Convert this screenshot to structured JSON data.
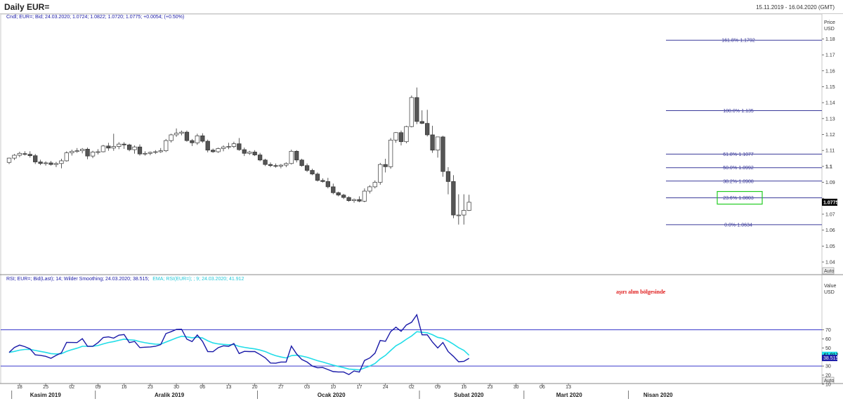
{
  "header": {
    "title": "Daily EUR=",
    "date_range": "15.11.2019 - 16.04.2020 (GMT)",
    "price_legend": "Cndl; EUR=; Bid; 24.03.2020; 1.0724; 1.0822; 1.0720; 1.0775; +0.0054; (+0.50%)",
    "rsi_legend_main": "RSI; EUR=; Bid(Last);  14; Wilder Smoothing; 24.03.2020; 38.515;",
    "rsi_legend_ema": "EMA; RSI(EUR=); ; 9; 24.03.2020; 41.912",
    "price_axis_title": "Price",
    "price_axis_unit": "USD",
    "rsi_axis_title": "Value",
    "rsi_axis_unit": "USD",
    "auto_label": "Auto",
    "annotation": "aşırı alım bölgesinde"
  },
  "colors": {
    "candle_up_fill": "#ffffff",
    "candle_down_fill": "#555555",
    "fib_line": "#3a3a9a",
    "rsi_line": "#1a1aa8",
    "ema_line": "#22dde8",
    "rsi_bands": "#3a3acc",
    "annotation": "#e02020",
    "highlight_box": "#22cc22",
    "last_price_tag": "#000000"
  },
  "chart_data": [
    {
      "type": "candlestick",
      "y_axis_ticks": [
        1.04,
        1.05,
        1.06,
        1.07,
        1.08,
        1.09,
        1.1,
        1.11,
        1.12,
        1.13,
        1.14,
        1.15,
        1.16,
        1.17,
        1.18
      ],
      "y_axis_tick_labels": [
        "1.04",
        "1.05",
        "1.06",
        "1.07",
        "",
        "1.09",
        "1.1",
        "1.11",
        "1.12",
        "1.13",
        "1.14",
        "1.15",
        "1.16",
        "1.17",
        "1.18"
      ],
      "ylim": [
        1.034,
        1.187
      ],
      "last_price": "1.0775",
      "fibonacci_levels": [
        {
          "label": "161.8%-1.1792",
          "value": 1.1792
        },
        {
          "label": "100.0%-1.135",
          "value": 1.135
        },
        {
          "label": "61.8%-1.1077",
          "value": 1.1077
        },
        {
          "label": "50.0%-1.0992",
          "value": 1.0992
        },
        {
          "label": "38.2%-1.0908",
          "value": 1.0908
        },
        {
          "label": "23.6%-1.0803",
          "value": 1.0803
        },
        {
          "label": "0.0%-1.0634",
          "value": 1.0634
        }
      ],
      "candles": [
        [
          1.1025,
          1.1055,
          1.1015,
          1.1052
        ],
        [
          1.1052,
          1.1078,
          1.104,
          1.107
        ],
        [
          1.107,
          1.1092,
          1.1058,
          1.1082
        ],
        [
          1.108,
          1.1095,
          1.1068,
          1.1076
        ],
        [
          1.1076,
          1.1095,
          1.1055,
          1.1067
        ],
        [
          1.1067,
          1.1078,
          1.1015,
          1.1028
        ],
        [
          1.1028,
          1.1042,
          1.1008,
          1.1018
        ],
        [
          1.1018,
          1.1032,
          1.1005,
          1.1022
        ],
        [
          1.1022,
          1.1034,
          1.1005,
          1.1012
        ],
        [
          1.1012,
          1.1028,
          1.0995,
          1.1018
        ],
        [
          1.1018,
          1.1048,
          1.0988,
          1.1035
        ],
        [
          1.1035,
          1.1095,
          1.103,
          1.1085
        ],
        [
          1.1085,
          1.1105,
          1.1068,
          1.1095
        ],
        [
          1.1095,
          1.1115,
          1.1085,
          1.1098
        ],
        [
          1.1098,
          1.1115,
          1.1082,
          1.1108
        ],
        [
          1.1108,
          1.1118,
          1.1045,
          1.1065
        ],
        [
          1.1065,
          1.1098,
          1.1052,
          1.109
        ],
        [
          1.109,
          1.1108,
          1.1075,
          1.1092
        ],
        [
          1.1092,
          1.1135,
          1.1088,
          1.1128
        ],
        [
          1.1128,
          1.1148,
          1.1098,
          1.1115
        ],
        [
          1.1115,
          1.1205,
          1.1098,
          1.1125
        ],
        [
          1.1125,
          1.1152,
          1.1108,
          1.114
        ],
        [
          1.114,
          1.1152,
          1.111,
          1.1135
        ],
        [
          1.1135,
          1.1142,
          1.1095,
          1.1105
        ],
        [
          1.1105,
          1.1132,
          1.108,
          1.1122
        ],
        [
          1.1122,
          1.1138,
          1.1068,
          1.1078
        ],
        [
          1.1078,
          1.1095,
          1.1068,
          1.1082
        ],
        [
          1.1082,
          1.1093,
          1.107,
          1.1088
        ],
        [
          1.1088,
          1.1102,
          1.1078,
          1.1092
        ],
        [
          1.1092,
          1.1115,
          1.1085,
          1.1098
        ],
        [
          1.1098,
          1.1172,
          1.109,
          1.1162
        ],
        [
          1.1162,
          1.1205,
          1.115,
          1.1198
        ],
        [
          1.1198,
          1.1238,
          1.1185,
          1.1208
        ],
        [
          1.1208,
          1.1225,
          1.1195,
          1.1215
        ],
        [
          1.1215,
          1.1225,
          1.1155,
          1.1162
        ],
        [
          1.1162,
          1.1172,
          1.1128,
          1.1148
        ],
        [
          1.1148,
          1.1205,
          1.1135,
          1.1192
        ],
        [
          1.1192,
          1.1208,
          1.1148,
          1.1158
        ],
        [
          1.1158,
          1.1168,
          1.1088,
          1.1102
        ],
        [
          1.1102,
          1.1112,
          1.1085,
          1.1092
        ],
        [
          1.1092,
          1.1118,
          1.1085,
          1.1112
        ],
        [
          1.1112,
          1.1132,
          1.1095,
          1.1122
        ],
        [
          1.1122,
          1.1148,
          1.1108,
          1.1125
        ],
        [
          1.1125,
          1.1155,
          1.1115,
          1.1142
        ],
        [
          1.1142,
          1.1178,
          1.1098,
          1.1105
        ],
        [
          1.1105,
          1.1118,
          1.1065,
          1.1082
        ],
        [
          1.1082,
          1.1098,
          1.1072,
          1.109
        ],
        [
          1.109,
          1.1102,
          1.1065,
          1.1072
        ],
        [
          1.1072,
          1.1085,
          1.1032,
          1.104
        ],
        [
          1.104,
          1.1048,
          1.1002,
          1.1012
        ],
        [
          1.1012,
          1.1025,
          1.0995,
          1.1005
        ],
        [
          1.1005,
          1.1018,
          1.0992,
          1.1002
        ],
        [
          1.1002,
          1.1015,
          1.0988,
          1.1008
        ],
        [
          1.1008,
          1.1025,
          1.0995,
          1.1018
        ],
        [
          1.1018,
          1.1105,
          1.1012,
          1.1095
        ],
        [
          1.1095,
          1.1102,
          1.1025,
          1.104
        ],
        [
          1.104,
          1.1048,
          1.0998,
          1.1005
        ],
        [
          1.1005,
          1.1018,
          1.0965,
          1.0975
        ],
        [
          1.0975,
          1.0985,
          1.0945,
          1.0952
        ],
        [
          1.0952,
          1.0962,
          1.0905,
          1.0912
        ],
        [
          1.0912,
          1.0925,
          1.0898,
          1.0905
        ],
        [
          1.0905,
          1.0928,
          1.0862,
          1.0872
        ],
        [
          1.0872,
          1.0892,
          1.0825,
          1.0835
        ],
        [
          1.0835,
          1.0842,
          1.0812,
          1.082
        ],
        [
          1.082,
          1.0828,
          1.0795,
          1.0805
        ],
        [
          1.0805,
          1.0812,
          1.0778,
          1.0785
        ],
        [
          1.0785,
          1.0798,
          1.0772,
          1.0792
        ],
        [
          1.0792,
          1.0812,
          1.0775,
          1.0782
        ],
        [
          1.0782,
          1.0862,
          1.0775,
          1.0845
        ],
        [
          1.0845,
          1.0882,
          1.083,
          1.0872
        ],
        [
          1.0872,
          1.0912,
          1.0862,
          1.09
        ],
        [
          1.09,
          1.1022,
          1.0885,
          1.1012
        ],
        [
          1.1012,
          1.1048,
          1.0962,
          1.0998
        ],
        [
          1.0998,
          1.1178,
          1.0985,
          1.1165
        ],
        [
          1.1165,
          1.1215,
          1.1148,
          1.1212
        ],
        [
          1.1212,
          1.1225,
          1.1132,
          1.1155
        ],
        [
          1.1155,
          1.1255,
          1.1145,
          1.125
        ],
        [
          1.125,
          1.1445,
          1.1245,
          1.1432
        ],
        [
          1.1432,
          1.1495,
          1.1265,
          1.1282
        ],
        [
          1.1282,
          1.1352,
          1.1265,
          1.127
        ],
        [
          1.127,
          1.1355,
          1.1188,
          1.1198
        ],
        [
          1.1198,
          1.1255,
          1.1085,
          1.1102
        ],
        [
          1.1102,
          1.1185,
          1.1055,
          1.1185
        ],
        [
          1.1185,
          1.1192,
          1.0935,
          1.0968
        ],
        [
          1.0968,
          1.0995,
          1.0825,
          1.0905
        ],
        [
          1.0905,
          1.0945,
          1.0675,
          1.0695
        ],
        [
          1.0695,
          1.0825,
          1.0635,
          1.0695
        ],
        [
          1.0695,
          1.0825,
          1.0635,
          1.0724
        ],
        [
          1.0724,
          1.0822,
          1.072,
          1.0775
        ]
      ]
    },
    {
      "type": "line",
      "name": "RSI",
      "y_axis_ticks": [
        10,
        20,
        30,
        40,
        50,
        60,
        70
      ],
      "ylim": [
        0,
        100
      ],
      "overbought": 70,
      "oversold": 30,
      "last_rsi": "38.515",
      "last_ema": "41.912",
      "rsi_values": [
        45.0,
        50.5,
        53.1,
        51.4,
        48.9,
        42.3,
        41.8,
        40.7,
        38.5,
        41.8,
        44.5,
        56.1,
        56.0,
        55.9,
        60.2,
        51.8,
        51.7,
        55.8,
        61.5,
        62.2,
        60.8,
        64.0,
        64.7,
        55.9,
        57.1,
        50.4,
        50.8,
        51.1,
        51.8,
        53.7,
        65.8,
        67.9,
        70.4,
        70.6,
        59.6,
        57.0,
        64.3,
        57.2,
        46.0,
        45.8,
        50.2,
        52.3,
        51.8,
        54.8,
        43.8,
        46.2,
        46.0,
        46.0,
        42.7,
        39.1,
        33.3,
        33.1,
        34.4,
        34.4,
        52.0,
        43.3,
        37.2,
        34.4,
        30.0,
        28.1,
        28.4,
        26.1,
        23.9,
        23.4,
        23.4,
        20.6,
        24.6,
        23.3,
        36.1,
        38.9,
        44.2,
        58.2,
        57.3,
        68.0,
        72.9,
        68.3,
        75.3,
        78.3,
        86.6,
        64.4,
        64.5,
        56.4,
        49.9,
        55.9,
        45.9,
        40.7,
        34.7,
        35.1,
        38.5
      ],
      "ema_values": [
        45.0,
        46.1,
        47.5,
        48.3,
        48.4,
        47.2,
        46.1,
        45.0,
        43.7,
        43.3,
        43.6,
        46.1,
        48.1,
        49.7,
        51.8,
        51.8,
        51.8,
        52.6,
        54.4,
        56.0,
        57.0,
        58.4,
        59.7,
        58.9,
        58.5,
        56.9,
        55.7,
        54.8,
        54.2,
        54.1,
        56.4,
        58.7,
        61.0,
        62.9,
        62.2,
        61.2,
        61.8,
        60.9,
        57.9,
        55.5,
        54.4,
        53.9,
        53.5,
        53.7,
        51.7,
        50.6,
        49.7,
        48.9,
        47.7,
        46.0,
        43.5,
        41.4,
        40.0,
        38.9,
        41.5,
        41.9,
        41.0,
        39.7,
        37.8,
        35.9,
        34.4,
        32.7,
        31.0,
        29.5,
        28.3,
        26.7,
        26.3,
        25.7,
        27.8,
        30.0,
        32.8,
        37.9,
        41.8,
        47.1,
        52.3,
        55.5,
        59.5,
        63.2,
        67.9,
        67.2,
        66.7,
        64.6,
        61.6,
        60.5,
        57.6,
        54.2,
        50.3,
        47.3,
        41.912
      ]
    }
  ],
  "x_axis": {
    "day_ticks": [
      "18",
      "25",
      "02",
      "09",
      "16",
      "23",
      "30",
      "06",
      "13",
      "20",
      "27",
      "03",
      "10",
      "17",
      "24",
      "02",
      "09",
      "16",
      "23",
      "30",
      "06",
      "13"
    ],
    "month_labels": [
      "Kasim 2019",
      "Aralik 2019",
      "Ocak 2020",
      "Subat 2020",
      "Mart 2020",
      "Nisan 2020"
    ]
  }
}
